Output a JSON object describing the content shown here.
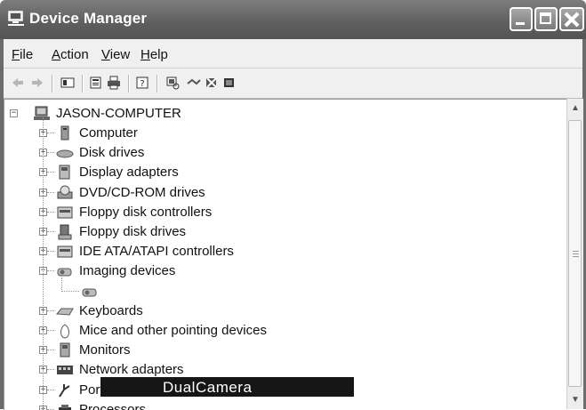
{
  "window": {
    "title": "Device Manager"
  },
  "menu": [
    {
      "prefix": "",
      "underline": "F",
      "rest": "ile"
    },
    {
      "prefix": "",
      "underline": "A",
      "rest": "ction"
    },
    {
      "prefix": "",
      "underline": "V",
      "rest": "iew"
    },
    {
      "prefix": "",
      "underline": "H",
      "rest": "elp"
    }
  ],
  "toolbar": {
    "icons": [
      "back-icon",
      "forward-icon",
      "show-hide-console-tree-icon",
      "properties-icon",
      "print-icon",
      "help-icon",
      "scan-hardware-icon",
      "update-driver-icon",
      "uninstall-icon",
      "disable-icon"
    ]
  },
  "tree": {
    "root": "JASON-COMPUTER",
    "items": [
      {
        "label": "Computer",
        "icon": "computer-icon"
      },
      {
        "label": "Disk drives",
        "icon": "disk-drive-icon"
      },
      {
        "label": "Display adapters",
        "icon": "display-adapter-icon"
      },
      {
        "label": "DVD/CD-ROM drives",
        "icon": "dvd-drive-icon"
      },
      {
        "label": "Floppy disk controllers",
        "icon": "floppy-controller-icon"
      },
      {
        "label": "Floppy disk drives",
        "icon": "floppy-drive-icon"
      },
      {
        "label": "IDE ATA/ATAPI controllers",
        "icon": "ide-controller-icon"
      },
      {
        "label": "Imaging devices",
        "icon": "camera-icon",
        "expanded": true
      },
      {
        "label": "DualCamera",
        "icon": "camera-icon",
        "child": true,
        "selected": true
      },
      {
        "label": "Keyboards",
        "icon": "keyboard-icon"
      },
      {
        "label": "Mice and other pointing devices",
        "icon": "mouse-icon"
      },
      {
        "label": "Monitors",
        "icon": "monitor-icon"
      },
      {
        "label": "Network adapters",
        "icon": "network-adapter-icon"
      },
      {
        "label": "Ports (COM & LPT)",
        "icon": "port-icon"
      },
      {
        "label": "Processors",
        "icon": "processor-icon"
      }
    ]
  }
}
